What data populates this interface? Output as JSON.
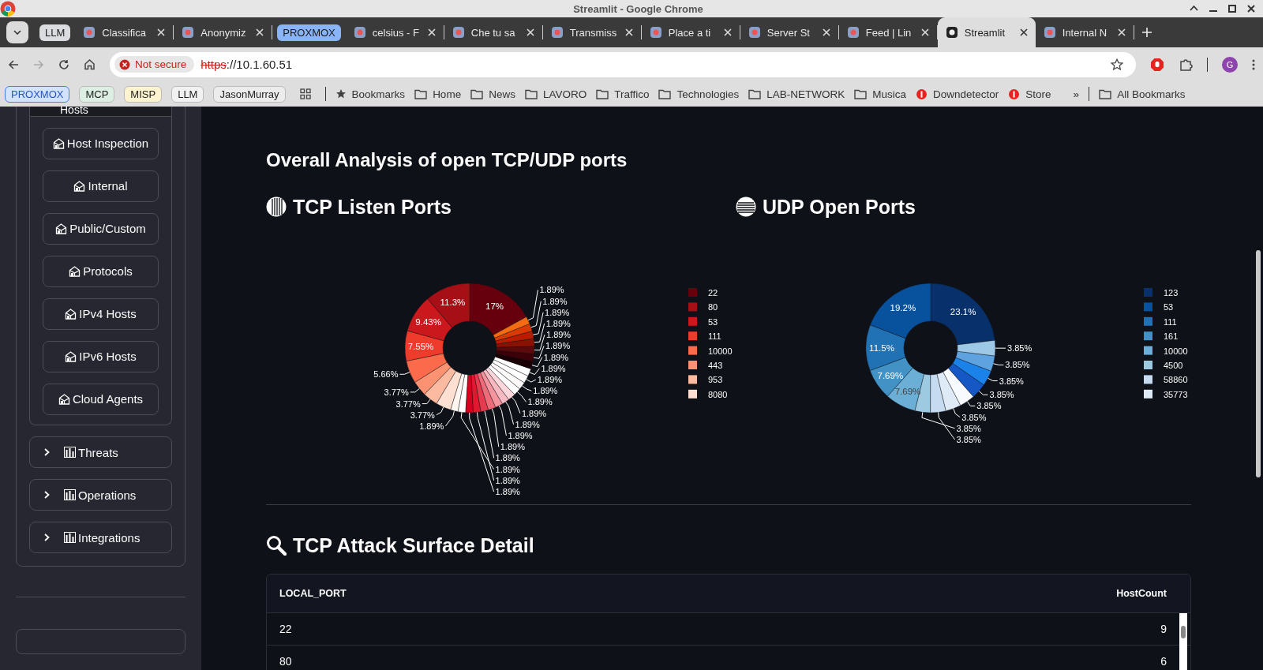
{
  "window": {
    "title": "Streamlit - Google Chrome"
  },
  "tabs": [
    {
      "kind": "group",
      "label": "LLM",
      "color": "#dadce0"
    },
    {
      "kind": "tab",
      "label": "Classifica",
      "selected": false
    },
    {
      "kind": "tab",
      "label": "Anonymiz",
      "selected": false
    },
    {
      "kind": "group",
      "label": "PROXMOX",
      "color": "#8ab4f8"
    },
    {
      "kind": "tab",
      "label": "celsius - F",
      "selected": false
    },
    {
      "kind": "tab",
      "label": "Che tu sa",
      "selected": false
    },
    {
      "kind": "tab",
      "label": "Transmiss",
      "selected": false
    },
    {
      "kind": "tab",
      "label": "Place a ti",
      "selected": false
    },
    {
      "kind": "tab",
      "label": "Server St",
      "selected": false
    },
    {
      "kind": "tab",
      "label": "Feed | Lin",
      "selected": false
    },
    {
      "kind": "tab",
      "label": "Streamlit",
      "selected": true
    },
    {
      "kind": "tab",
      "label": "Internal N",
      "selected": false
    }
  ],
  "toolbar": {
    "security": "Not secure",
    "url_scheme": "https",
    "url_rest": "://10.1.60.51",
    "profile": "G"
  },
  "bookmarks": [
    {
      "kind": "chip",
      "label": "PROXMOX",
      "color": "#d3e3fd"
    },
    {
      "kind": "chip",
      "label": "MCP",
      "color": "#dcefe2"
    },
    {
      "kind": "chip",
      "label": "MISP",
      "color": "#fdf3cf"
    },
    {
      "kind": "chip",
      "label": "LLM",
      "color": "#f1f1f1"
    },
    {
      "kind": "chip",
      "label": "JasonMurray",
      "color": "#ececec"
    },
    {
      "kind": "apps"
    },
    {
      "kind": "star",
      "label": "Bookmarks"
    },
    {
      "kind": "folder",
      "label": "Home"
    },
    {
      "kind": "folder",
      "label": "News"
    },
    {
      "kind": "folder",
      "label": "LAVORO"
    },
    {
      "kind": "folder",
      "label": "Traffico"
    },
    {
      "kind": "folder",
      "label": "Technologies"
    },
    {
      "kind": "folder",
      "label": "LAB-NETWORK"
    },
    {
      "kind": "folder",
      "label": "Musica"
    },
    {
      "kind": "site",
      "label": "Downdetector"
    },
    {
      "kind": "site",
      "label": "Store"
    },
    {
      "kind": "more",
      "label": "»"
    },
    {
      "kind": "folder",
      "label": "All Bookmarks"
    }
  ],
  "sidebar": {
    "group_title": "Hosts",
    "buttons": [
      "Host Inspection",
      "Internal",
      "Public/Custom",
      "Protocols",
      "IPv4 Hosts",
      "IPv6 Hosts",
      "Cloud Agents"
    ],
    "expanders": [
      {
        "label": "Threats",
        "expanded": false
      },
      {
        "label": "Operations",
        "expanded": false
      },
      {
        "label": "Integrations",
        "expanded": false
      }
    ]
  },
  "main": {
    "title": "Overall Analysis of open TCP/UDP ports",
    "charts": [
      {
        "heading": "TCP Listen Ports",
        "chart_data": {
          "type": "donut",
          "categories": [
            "22",
            "80",
            "53",
            "111",
            "10000",
            "443",
            "953",
            "8080",
            null,
            null,
            null,
            null,
            null,
            null,
            null,
            null,
            null,
            null,
            null,
            null,
            null,
            null,
            null,
            null,
            null,
            null,
            null,
            null
          ],
          "values": [
            17,
            11.3,
            9.43,
            7.55,
            5.66,
            3.77,
            3.77,
            3.77,
            1.89,
            1.89,
            1.89,
            1.89,
            1.89,
            1.89,
            1.89,
            1.89,
            1.89,
            1.89,
            1.89,
            1.89,
            1.89,
            1.89,
            1.89,
            1.89,
            1.89,
            1.89,
            1.89,
            1.89
          ],
          "value_labels": [
            "17%",
            "11.3%",
            "9.43%",
            "7.55%",
            "5.66%",
            "3.77%",
            "3.77%",
            "3.77%",
            "1.89%",
            "1.89%",
            "1.89%",
            "1.89%",
            "1.89%",
            "1.89%",
            "1.89%",
            "1.89%",
            "1.89%",
            "1.89%",
            "1.89%",
            "1.89%",
            "1.89%",
            "1.89%",
            "1.89%",
            "1.89%",
            "1.89%",
            "1.89%",
            "1.89%",
            "1.89%"
          ],
          "legend": "right"
        }
      },
      {
        "heading": "UDP Open Ports",
        "chart_data": {
          "type": "donut",
          "categories": [
            "123",
            "53",
            "111",
            "161",
            "10000",
            "4500",
            "58860",
            "35773",
            null,
            null,
            null,
            null,
            null
          ],
          "values": [
            23.1,
            19.2,
            11.5,
            7.69,
            7.69,
            3.85,
            3.85,
            3.85,
            3.85,
            3.85,
            3.85,
            3.85,
            3.85
          ],
          "value_labels": [
            "23.1%",
            "19.2%",
            "11.5%",
            "7.69%",
            "7.69%",
            "3.85%",
            "3.85%",
            "3.85%",
            "3.85%",
            "3.85%",
            "3.85%",
            "3.85%",
            "3.85%"
          ],
          "legend": "right"
        }
      }
    ],
    "table_section": {
      "heading": "TCP Attack Surface Detail",
      "columns": [
        "LOCAL_PORT",
        "HostCount"
      ],
      "rows": [
        [
          "22",
          "9"
        ],
        [
          "80",
          "6"
        ]
      ]
    }
  }
}
